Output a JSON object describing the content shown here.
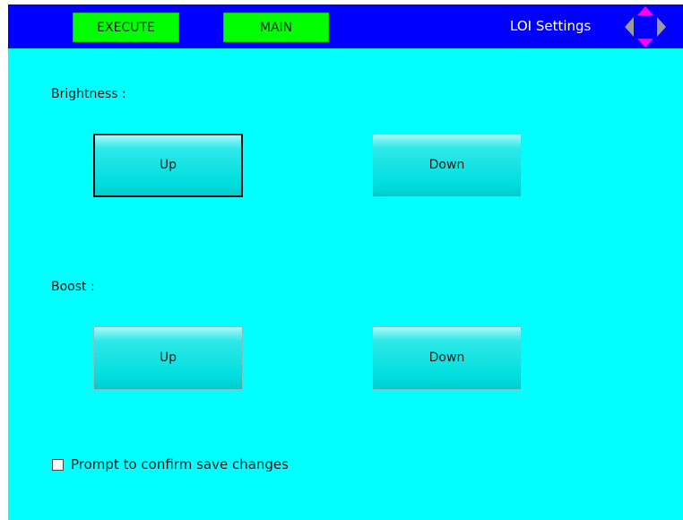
{
  "header": {
    "execute_label": "EXECUTE",
    "main_label": "MAIN",
    "title": "LOI Settings",
    "nav_icon": "four-way-arrows-icon"
  },
  "brightness": {
    "label": "Brightness :",
    "up_label": "Up",
    "down_label": "Down"
  },
  "boost": {
    "label": "Boost :",
    "up_label": "Up",
    "down_label": "Down"
  },
  "confirm": {
    "label": "Prompt to confirm save changes",
    "checked": false
  },
  "colors": {
    "background": "#00ffff",
    "header": "#0000ff",
    "nav_button": "#00ff00",
    "arrow_magenta": "#ff00ff",
    "arrow_gray": "#9a9a9a"
  }
}
